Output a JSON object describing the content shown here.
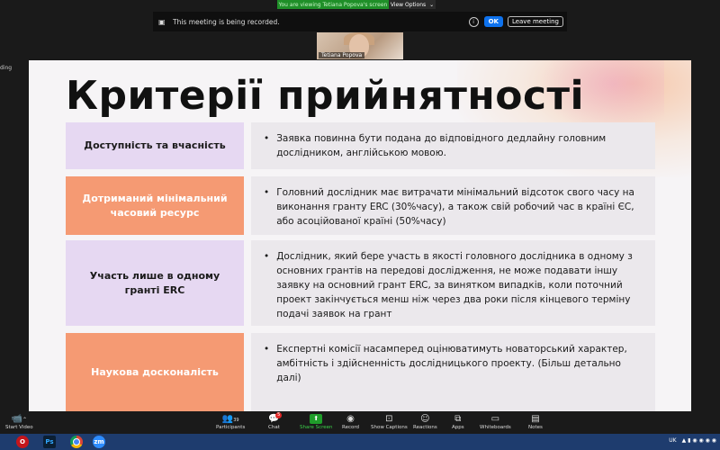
{
  "banner": {
    "viewing": "You are viewing Tetiana Popova's screen",
    "options": "View Options"
  },
  "recording": {
    "text": "This meeting is being recorded.",
    "ok": "OK",
    "leave": "Leave meeting"
  },
  "video": {
    "name": "Tetiana Popova"
  },
  "sidebar_text": "ding",
  "slide": {
    "title": "Критерії прийнятності",
    "rows": [
      {
        "label": "Доступність та вчасність",
        "text": "Заявка повинна бути подана до відповідного дедлайну головним дослідником, англійською мовою.",
        "color": "#e6d8f2"
      },
      {
        "label": "Дотриманий мінімальний часовий ресурс",
        "text": "Головний дослідник має витрачати мінімальний відсоток свого часу на виконання гранту ERC  (30%часу), а також свій робочий час в країні ЄС, або асоційованої країні (50%часу)",
        "color": "#f59a73"
      },
      {
        "label": "Участь лише в одному гранті ERC",
        "text": "Дослідник, який бере участь в якості головного дослідника в одному з основних грантів на передові дослідження, не може подавати іншу заявку на основний грант ERC, за винятком випадків, коли поточний проект закінчується менш ніж через два роки після кінцевого терміну подачі заявок на грант",
        "color": "#e6d8f2"
      },
      {
        "label": "Наукова досконалість",
        "text": "Експертні комісії насамперед оцінюватимуть новаторський характер, амбітність і здійсненність дослідницького проекту.  (Більш детально далі)",
        "color": "#f59a73"
      }
    ]
  },
  "toolbar": {
    "start_video": "Start Video",
    "participants": "Participants",
    "participants_count": "39",
    "chat": "Chat",
    "chat_badge": "5",
    "share_screen": "Share Screen",
    "record": "Record",
    "show_captions": "Show Captions",
    "reactions": "Reactions",
    "apps": "Apps",
    "whiteboards": "Whiteboards",
    "notes": "Notes"
  },
  "taskbar": {
    "lang": "UK",
    "icons": [
      "opera-icon",
      "photoshop-icon",
      "chrome-icon",
      "zoom-icon"
    ],
    "ps": "Ps",
    "zm": "zm"
  }
}
